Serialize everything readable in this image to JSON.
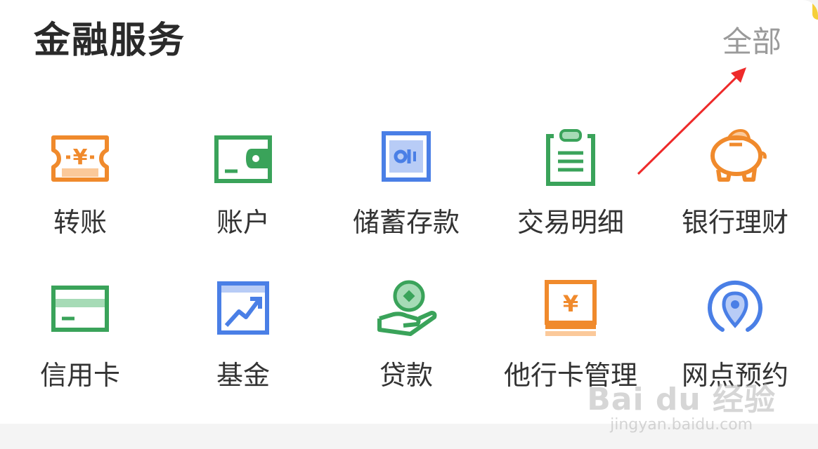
{
  "section": {
    "title": "金融服务",
    "all_label": "全部"
  },
  "services": [
    {
      "label": "转账",
      "icon": "transfer-yen-icon",
      "color": "#f08a2c"
    },
    {
      "label": "账户",
      "icon": "wallet-icon",
      "color": "#3aa35a"
    },
    {
      "label": "储蓄存款",
      "icon": "safe-icon",
      "color": "#4a7fe6"
    },
    {
      "label": "交易明细",
      "icon": "clipboard-icon",
      "color": "#3aa35a"
    },
    {
      "label": "银行理财",
      "icon": "piggy-bank-icon",
      "color": "#f08a2c"
    },
    {
      "label": "信用卡",
      "icon": "credit-card-icon",
      "color": "#3aa35a"
    },
    {
      "label": "基金",
      "icon": "chart-trend-icon",
      "color": "#4a7fe6"
    },
    {
      "label": "贷款",
      "icon": "coin-hand-icon",
      "color": "#3aa35a"
    },
    {
      "label": "他行卡管理",
      "icon": "yen-card-icon",
      "color": "#f08a2c"
    },
    {
      "label": "网点预约",
      "icon": "location-pin-icon",
      "color": "#4a7fe6"
    }
  ],
  "watermark": {
    "logo": "Bai du 经验",
    "url": "jingyan.baidu.com"
  },
  "colors": {
    "orange": "#f08a2c",
    "green": "#3aa35a",
    "blue": "#4a7fe6",
    "arrow": "#ee2a2a",
    "accent_yellow": "#f5cf3a"
  }
}
